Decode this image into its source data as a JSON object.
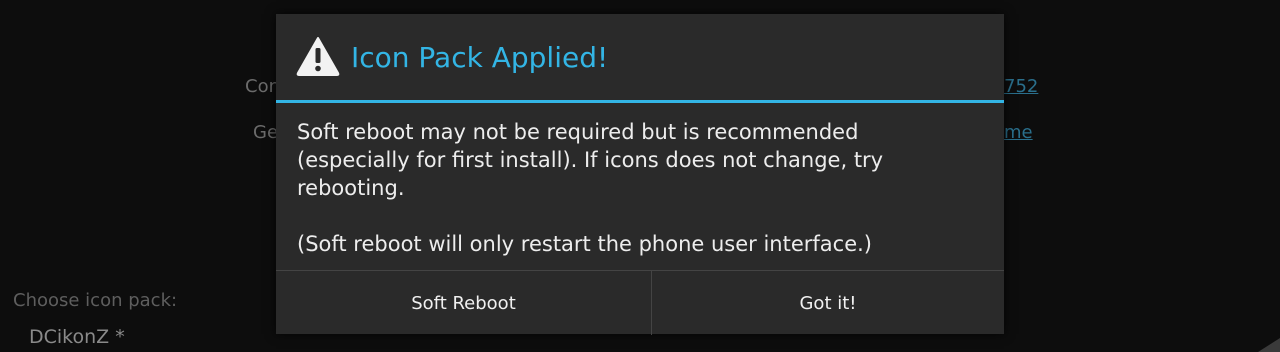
{
  "background": {
    "fragment_top_left": "Con",
    "fragment_mid_left": "Ge",
    "fragment_top_right": "752",
    "fragment_mid_right": "me",
    "choose_label": "Choose icon pack:",
    "selected_pack": "DCikonZ *"
  },
  "dialog": {
    "icon": "warning-icon",
    "title": "Icon Pack Applied!",
    "body_line1": "Soft reboot may not be required but is recommended",
    "body_line2": "(especially for first install). If icons does not change, try",
    "body_line3": "rebooting.",
    "body_line4": "(Soft reboot will only restart the phone user interface.)",
    "accent_color": "#33b5e5",
    "buttons": {
      "soft_reboot": "Soft Reboot",
      "got_it": "Got it!"
    }
  }
}
